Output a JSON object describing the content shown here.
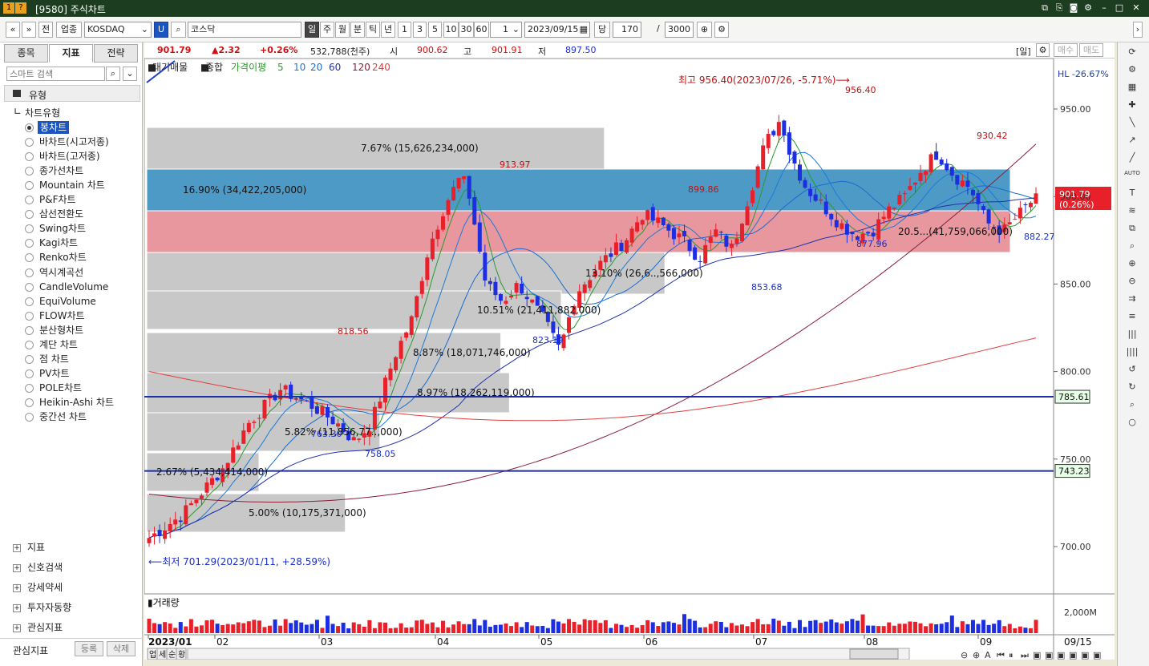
{
  "window": {
    "title": "[9580] 주식차트",
    "badges": [
      "1",
      "?"
    ]
  },
  "toolbar": {
    "b1": "«",
    "b2": "»",
    "b3": "전",
    "b4": "업종",
    "market": "KOSDAQ",
    "u": "U",
    "item": "코스닥",
    "periods": [
      "일",
      "주",
      "월",
      "분",
      "틱",
      "년"
    ],
    "nums": [
      "1",
      "3",
      "5",
      "10",
      "30",
      "60"
    ],
    "n1": "1",
    "date": "2023/09/15",
    "d": "당",
    "count": "170",
    "slash": "/",
    "total": "3000"
  },
  "left": {
    "tabs": [
      "종목",
      "지표",
      "전략"
    ],
    "search_placeholder": "스마트 검색",
    "section": "유형",
    "group": "차트유형",
    "types": [
      "봉차트",
      "바차트(시고저종)",
      "바차트(고저종)",
      "종가선차트",
      "Mountain 차트",
      "P&F차트",
      "삼선전환도",
      "Swing차트",
      "Kagi차트",
      "Renko차트",
      "역시계곡선",
      "CandleVolume",
      "EquiVolume",
      "FLOW차트",
      "분산형차트",
      "계단 차트",
      "점 차트",
      "PV차트",
      "POLE차트",
      "Heikin-Ashi 차트",
      "중간선 차트"
    ],
    "sections": [
      "지표",
      "신호검색",
      "강세약세",
      "투자자동향",
      "관심지표"
    ],
    "bottom": {
      "label": "관심지표",
      "reg": "등록",
      "del": "삭제"
    }
  },
  "quote": {
    "price": "901.79",
    "change": "▲2.32",
    "pct": "+0.26%",
    "vol": "532,788(천주)",
    "o_l": "시",
    "o": "900.62",
    "h_l": "고",
    "h": "901.91",
    "l_l": "저",
    "l": "897.50",
    "period": "[일]",
    "buy": "매수",
    "sell": "매도"
  },
  "legend": {
    "a": "대기매물",
    "b": "종합",
    "ma_label": "가격이평",
    "mas": [
      "5",
      "10",
      "20",
      "60",
      "120",
      "240"
    ]
  },
  "colors": {
    "up": "#e8202a",
    "down": "#1c2ee0",
    "ma5": "#2a9a2a",
    "ma10": "#1a7ad8",
    "ma20": "#1a6bd0",
    "ma60": "#2030b0",
    "ma120": "#8a1f3a",
    "ma240": "#e04040"
  },
  "annot": {
    "high": "최고 956.40(2023/07/26, -5.71%)⟶",
    "low": "⟵최저 701.29(2023/01/11, +28.59%)",
    "hl": "HL -26.67%",
    "cur": "901.79",
    "curpct": "(0.26%)",
    "lines": [
      "785.61",
      "743.23"
    ],
    "pts": [
      "956.40",
      "930.42",
      "913.97",
      "899.86",
      "877.96",
      "882.27",
      "853.68",
      "823.19",
      "818.56",
      "758.05",
      "763.30"
    ]
  },
  "profile": [
    {
      "label": "7.67% (15,626,234,000)",
      "frac": 0.53
    },
    {
      "label": "16.90% (34,422,205,000)",
      "frac": 1.0
    },
    {
      "label": "20.5...(41,759,066,000)",
      "frac": 1.0
    },
    {
      "label": "13.10% (26,6..,566,000)",
      "frac": 0.6
    },
    {
      "label": "10.51% (21,411,882,000)",
      "frac": 0.48
    },
    {
      "label": "8.87% (18,071,746,000)",
      "frac": 0.41
    },
    {
      "label": "8.97% (18,262,119,000)",
      "frac": 0.42
    },
    {
      "label": "5.82% (11,856,77..,000)",
      "frac": 0.27
    },
    {
      "label": "2.67% (5,434,414,000)",
      "frac": 0.13
    },
    {
      "label": "5.00% (10,175,371,000)",
      "frac": 0.23
    }
  ],
  "chart_data": {
    "type": "candlestick",
    "yaxis": [
      "950.00",
      "900.00",
      "850.00",
      "800.00",
      "750.00",
      "700.00"
    ],
    "ylim": [
      690,
      965
    ],
    "months": [
      "2023/01",
      "02",
      "03",
      "04",
      "05",
      "06",
      "07",
      "08",
      "09"
    ],
    "cur_date": "09/15",
    "vol_label": "거래량",
    "vol_axis": "2,000M",
    "n": 170
  },
  "bottom": {
    "tabs": [
      "업",
      "세",
      "순",
      "황"
    ]
  },
  "rtool": {
    "icons": [
      "refresh-icon",
      "gear-icon",
      "bar-icon",
      "line-icon",
      "cross-icon",
      "ray-icon",
      "trend-icon",
      "auto-icon",
      "text-icon",
      "fib-icon",
      "candle-icon",
      "zoom-icon",
      "zoomin-icon",
      "zoomout-icon",
      "pitch-icon",
      "channel-icon",
      "lines-icon",
      "lines2-icon",
      "undo-icon",
      "redo-icon",
      "search-icon",
      "circle-icon"
    ],
    "glyphs": [
      "⟳",
      "⚙",
      "▦",
      "✚",
      "╲",
      "↗",
      "╱",
      "AUTO",
      "T",
      "≋",
      "⧉",
      "⌕",
      "⊕",
      "⊖",
      "⇉",
      "≡",
      "|||",
      "||||",
      "↺",
      "↻",
      "⌕",
      "○"
    ]
  }
}
